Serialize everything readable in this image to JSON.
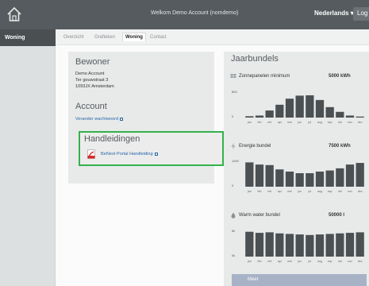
{
  "topbar": {
    "title": "Welkom Demo Account (nomdemo)",
    "language": "Nederlands ▾",
    "logout": "Log"
  },
  "sidebar": {
    "items": [
      {
        "label": "Woning"
      }
    ]
  },
  "tabs": [
    {
      "label": "Overzicht"
    },
    {
      "label": "Grafieken"
    },
    {
      "label": "Woning"
    },
    {
      "label": "Contact"
    }
  ],
  "bewoner": {
    "title": "Bewoner",
    "name": "Demo Account",
    "street": "Ter gouwstraat 3",
    "city": "1093JX Amsterdam"
  },
  "account": {
    "title": "Account",
    "change_password": "Verander wachtwoord"
  },
  "handleidingen": {
    "title": "Handleidingen",
    "link": "BeNext Portal Handleiding"
  },
  "jaarbundels": {
    "title": "Jaarbundels",
    "months": [
      "jan",
      "feb",
      "mrt",
      "apr",
      "mei",
      "jun",
      "jul",
      "aug",
      "sep",
      "okt",
      "nov",
      "dec"
    ],
    "bundles": [
      {
        "label": "Zonnepanelen minimum",
        "value": "5000 kWh",
        "ytop": "800",
        "ybottom": "0",
        "data": [
          40,
          60,
          210,
          380,
          560,
          650,
          660,
          520,
          310,
          170,
          60,
          30
        ],
        "max": 800,
        "icon": "solar-panel-icon"
      },
      {
        "label": "Energie bundel",
        "value": "7500 kWh",
        "ytop": "1000",
        "ybottom": "0",
        "data": [
          900,
          820,
          800,
          640,
          560,
          500,
          500,
          560,
          600,
          680,
          820,
          880
        ],
        "max": 1000,
        "icon": "lightning-icon"
      },
      {
        "label": "Warm water bundel",
        "value": "50000 l",
        "ytop": "5k",
        "ybottom": "0k",
        "data": [
          4600,
          4400,
          4500,
          4300,
          4200,
          4100,
          4000,
          4100,
          4200,
          4300,
          4400,
          4500
        ],
        "max": 5000,
        "icon": "water-drop-icon"
      }
    ],
    "meer": "Meer"
  },
  "colors": {
    "topbar": "#555b5e",
    "highlight": "#33b24a",
    "bar": "#4b5053",
    "link": "#2a67a8"
  }
}
